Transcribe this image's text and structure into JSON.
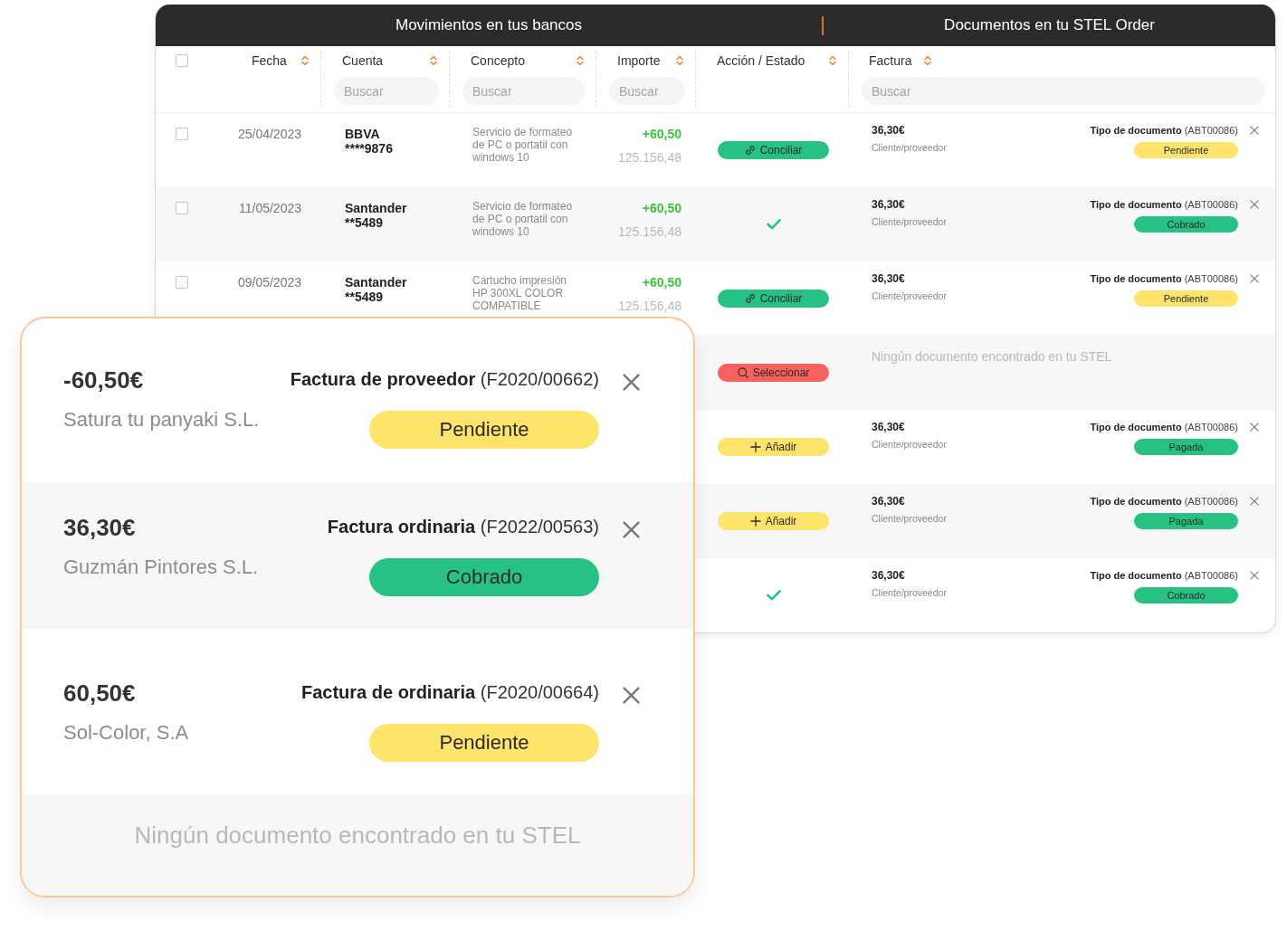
{
  "table": {
    "sections": [
      {
        "title": "Movimientos en tus bancos"
      },
      {
        "title": "Documentos en tu STEL Order"
      }
    ],
    "select_all": {
      "checked": false
    },
    "columns": [
      {
        "label": "Fecha"
      },
      {
        "label": "Cuenta",
        "search": {
          "placeholder": "Buscar"
        }
      },
      {
        "label": "Concepto",
        "search": {
          "placeholder": "Buscar"
        }
      },
      {
        "label": "Importe",
        "search": {
          "placeholder": "Buscar"
        }
      },
      {
        "label": "Acción / Estado"
      },
      {
        "label": "Factura",
        "search": {
          "placeholder": "Buscar"
        }
      }
    ],
    "rows": [
      {
        "checked": false,
        "date": "25/04/2023",
        "bank": "BBVA",
        "account_number": "****9876",
        "concept": "Servicio de formateo de PC o portatil con windows 10",
        "amount": "+60,50",
        "balance": "125.156,48",
        "action": {
          "kind": "reconcile",
          "label": "Conciliar"
        },
        "document": {
          "kind": "match",
          "amount": "36,30€",
          "party": "Cliente/proveedor",
          "type": "**Tipo de documento** (ABT00086)",
          "status": {
            "label": "Pendiente",
            "color": "#ffe46b"
          }
        }
      },
      {
        "checked": false,
        "date": "11/05/2023",
        "bank": "Santander",
        "account_number": "**5489",
        "concept": "Servicio de formateo de PC o portatil con windows 10",
        "amount": "+60,50",
        "balance": "125.156,48",
        "action": {
          "kind": "reconciled"
        },
        "document": {
          "kind": "match",
          "amount": "36,30€",
          "party": "Cliente/proveedor",
          "type": "**Tipo de documento** (ABT00086)",
          "status": {
            "label": "Cobrado",
            "color": "#27c283"
          }
        }
      },
      {
        "checked": false,
        "date": "09/05/2023",
        "bank": "Santander",
        "account_number": "**5489",
        "concept": "Cartucho impresión HP 300XL COLOR COMPATIBLE",
        "amount": "+60,50",
        "balance": "125.156,48",
        "action": {
          "kind": "reconcile",
          "label": "Conciliar"
        },
        "document": {
          "kind": "match",
          "amount": "36,30€",
          "party": "Cliente/proveedor",
          "type": "**Tipo de documento** (ABT00086)",
          "status": {
            "label": "Pendiente",
            "color": "#ffe46b"
          }
        }
      },
      {
        "action": {
          "kind": "select",
          "label": "Seleccionar"
        },
        "document": {
          "kind": "none",
          "message": "Ningún documento encontrado en tu STEL"
        }
      },
      {
        "action": {
          "kind": "add",
          "label": "Añadir"
        },
        "document": {
          "kind": "match",
          "amount": "36,30€",
          "party": "Cliente/proveedor",
          "type": "**Tipo de documento** (ABT00086)",
          "status": {
            "label": "Pagada",
            "color": "#27c283"
          }
        }
      },
      {
        "action": {
          "kind": "add",
          "label": "Añadir"
        },
        "document": {
          "kind": "match",
          "amount": "36,30€",
          "party": "Cliente/proveedor",
          "type": "**Tipo de documento** (ABT00086)",
          "status": {
            "label": "Pagada",
            "color": "#27c283"
          }
        }
      },
      {
        "action": {
          "kind": "reconciled"
        },
        "document": {
          "kind": "match",
          "amount": "36,30€",
          "party": "Cliente/proveedor",
          "type": "**Tipo de documento** (ABT00086)",
          "status": {
            "label": "Cobrado",
            "color": "#27c283"
          }
        }
      }
    ]
  },
  "match_panel": {
    "items": [
      {
        "kind": "match",
        "amount": "-60,50€",
        "party": "Satura tu panyaki S.L.",
        "type": "**Factura de proveedor** (F2020/00662)",
        "status": {
          "label": "Pendiente",
          "color": "#ffe46b"
        }
      },
      {
        "kind": "match",
        "amount": "36,30€",
        "party": "Guzmán Pintores S.L.",
        "type": "**Factura ordinaria** (F2022/00563)",
        "status": {
          "label": "Cobrado",
          "color": "#27c283"
        }
      },
      {
        "kind": "match",
        "amount": "60,50€",
        "party": "Sol-Color, S.A",
        "type": "**Factura de ordinaria** (F2020/00664)",
        "status": {
          "label": "Pendiente",
          "color": "#ffe46b"
        }
      },
      {
        "kind": "none",
        "message": "Ningún documento encontrado en tu STEL"
      }
    ]
  }
}
